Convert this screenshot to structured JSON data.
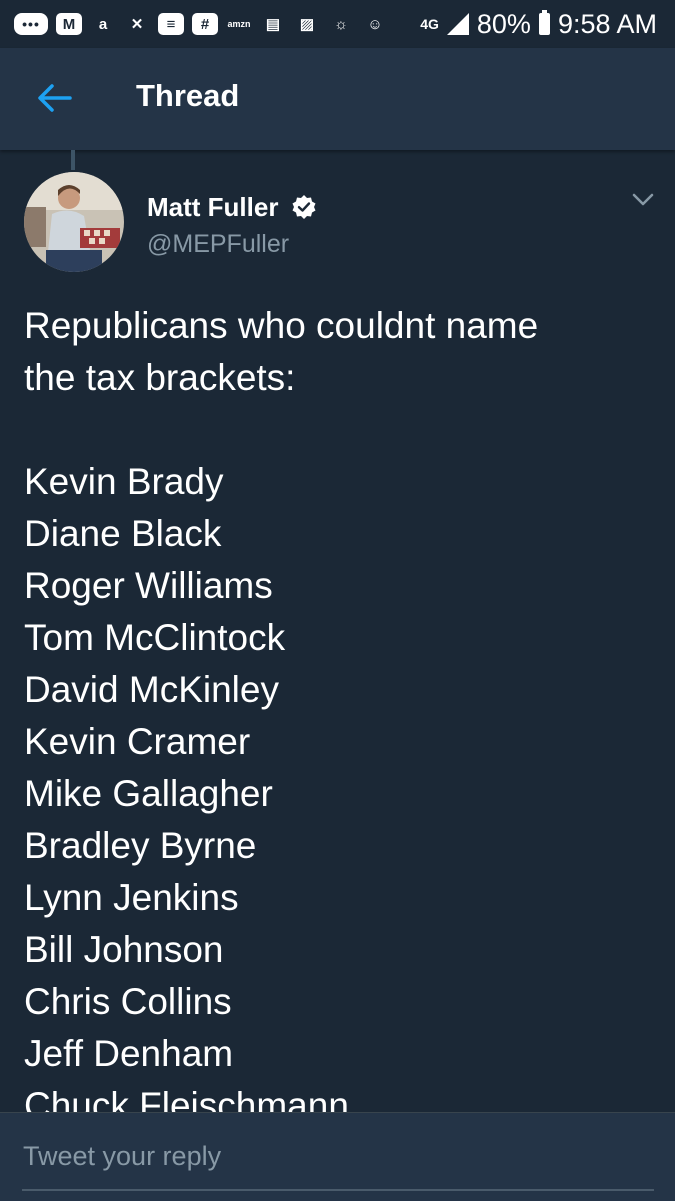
{
  "status_bar": {
    "notification_icons": [
      "more-dots-icon",
      "gmail-icon",
      "amazon-shopping-icon",
      "missed-call-icon",
      "notes-icon",
      "slack-icon",
      "amazon-icon",
      "calendar-icon",
      "gallery-icon",
      "weather-icon",
      "contacts-icon"
    ],
    "network": "4G",
    "battery": "80%",
    "time": "9:58 AM"
  },
  "header": {
    "title": "Thread",
    "back_icon": "back-arrow-icon"
  },
  "tweet": {
    "author_name": "Matt Fuller",
    "handle": "@MEPFuller",
    "verified": true,
    "intro_lines": [
      "Republicans who couldnt name",
      "the tax brackets:"
    ],
    "names": [
      "Kevin Brady",
      "Diane Black",
      "Roger Williams",
      "Tom McClintock",
      "David McKinley",
      "Kevin Cramer",
      "Mike Gallagher",
      "Bradley Byrne",
      "Lynn Jenkins",
      "Bill Johnson",
      "Chris Collins",
      "Jeff Denham",
      "Chuck Fleischmann"
    ]
  },
  "reply": {
    "placeholder": "Tweet your reply"
  },
  "colors": {
    "background": "#1b2836",
    "bar": "#243447",
    "accent": "#1da1f2",
    "secondary_text": "#8899a6"
  }
}
